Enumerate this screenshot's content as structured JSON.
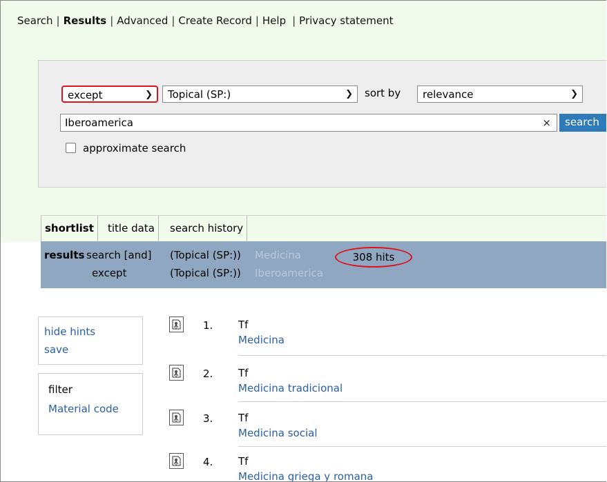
{
  "nav": {
    "items": [
      "Search",
      "Results",
      "Advanced",
      "Create Record",
      "Help",
      "Privacy statement"
    ],
    "active": "Results"
  },
  "search": {
    "operator": "except",
    "field": "Topical (SP:)",
    "sort_label": "sort by",
    "sort": "relevance",
    "query": "Iberoamerica",
    "clear": "×",
    "button": "search",
    "approx_label": "approximate search"
  },
  "tabs": [
    "shortlist",
    "title data",
    "search history"
  ],
  "results_bar": {
    "label": "results",
    "line1_prefix": "search [and]",
    "line1_field": "(Topical (SP:))",
    "line1_term": "Medicina",
    "line2_prefix": "except",
    "line2_field": "(Topical (SP:))",
    "line2_term": "Iberoamerica",
    "hits": "308 hits"
  },
  "sidebar": {
    "hide_hints": "hide hints",
    "save": "save",
    "filter_label": "filter",
    "material_code": "Material code"
  },
  "results": [
    {
      "num": "1.",
      "type": "Tf",
      "title": "Medicina"
    },
    {
      "num": "2.",
      "type": "Tf",
      "title": "Medicina tradicional"
    },
    {
      "num": "3.",
      "type": "Tf",
      "title": "Medicina social"
    },
    {
      "num": "4.",
      "type": "Tf",
      "title": "Medicina griega y romana"
    }
  ],
  "colors": {
    "accent_blue": "#2f7ab8",
    "results_bar": "#8fa7c0",
    "highlight_red": "#d9141c",
    "top_background": "#f1fbec"
  }
}
